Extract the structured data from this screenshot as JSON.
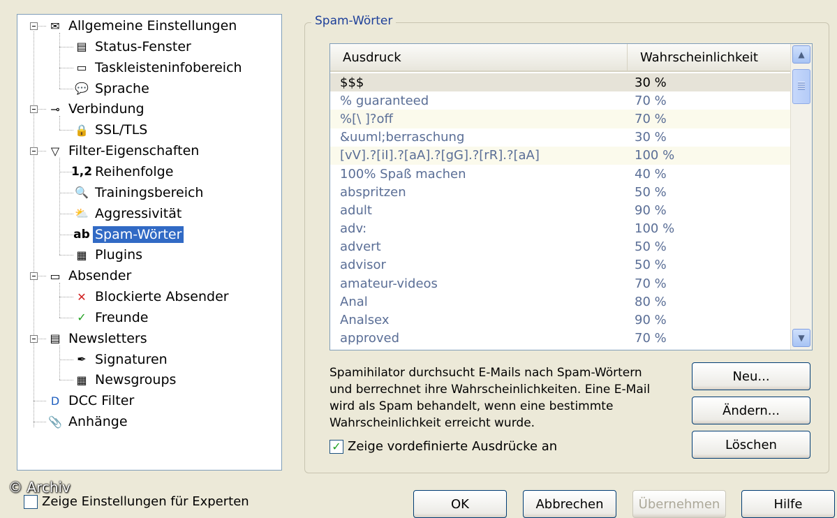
{
  "tree": {
    "items": [
      {
        "label": "Allgemeine Einstellungen",
        "icon": "envelope-settings-icon",
        "glyph": "✉"
      },
      {
        "label": "Status-Fenster",
        "icon": "status-window-icon",
        "glyph": "▤"
      },
      {
        "label": "Taskleisteninfobereich",
        "icon": "taskbar-icon",
        "glyph": "▭"
      },
      {
        "label": "Sprache",
        "icon": "language-bubble-icon",
        "glyph": "💬"
      },
      {
        "label": "Verbindung",
        "icon": "plug-icon",
        "glyph": "⊸"
      },
      {
        "label": "SSL/TLS",
        "icon": "lock-icon",
        "glyph": "🔒"
      },
      {
        "label": "Filter-Eigenschaften",
        "icon": "filter-icon",
        "glyph": "▽"
      },
      {
        "label": "Reihenfolge",
        "icon": "order-numbers-icon",
        "glyph": "1,2"
      },
      {
        "label": "Trainingsbereich",
        "icon": "training-icon",
        "glyph": "🔍"
      },
      {
        "label": "Aggressivität",
        "icon": "weather-icon",
        "glyph": "⛅"
      },
      {
        "label": "Spam-Wörter",
        "icon": "text-ab-icon",
        "glyph": "ab"
      },
      {
        "label": "Plugins",
        "icon": "plugins-icon",
        "glyph": "▦"
      },
      {
        "label": "Absender",
        "icon": "sender-card-icon",
        "glyph": "▭"
      },
      {
        "label": "Blockierte Absender",
        "icon": "red-x-icon",
        "glyph": "✕"
      },
      {
        "label": "Freunde",
        "icon": "green-check-icon",
        "glyph": "✓"
      },
      {
        "label": "Newsletters",
        "icon": "newsletter-icon",
        "glyph": "▤"
      },
      {
        "label": "Signaturen",
        "icon": "signature-icon",
        "glyph": "✒"
      },
      {
        "label": "Newsgroups",
        "icon": "newsgroups-icon",
        "glyph": "▦"
      },
      {
        "label": "DCC Filter",
        "icon": "dcc-icon",
        "glyph": "D"
      },
      {
        "label": "Anhänge",
        "icon": "paperclip-icon",
        "glyph": "📎"
      }
    ]
  },
  "group": {
    "title": "Spam-Wörter"
  },
  "list": {
    "columns": [
      "Ausdruck",
      "Wahrscheinlichkeit"
    ],
    "rows": [
      [
        "$$$",
        "30 %"
      ],
      [
        "% guaranteed",
        "70 %"
      ],
      [
        "%[\\ ]?off",
        "70 %"
      ],
      [
        "&uuml;berraschung",
        "30 %"
      ],
      [
        "[vV].?[iI].?[aA].?[gG].?[rR].?[aA]",
        "100 %"
      ],
      [
        "100% Spaß machen",
        "40 %"
      ],
      [
        "abspritzen",
        "50 %"
      ],
      [
        "adult",
        "90 %"
      ],
      [
        "adv:",
        "100 %"
      ],
      [
        "advert",
        "50 %"
      ],
      [
        "advisor",
        "50 %"
      ],
      [
        "amateur-videos",
        "70 %"
      ],
      [
        "Anal",
        "80 %"
      ],
      [
        "Analsex",
        "90 %"
      ],
      [
        "approved",
        "70 %"
      ]
    ]
  },
  "description": [
    "Spamihilator durchsucht E-Mails nach Spam-Wörtern",
    "und berrechnet ihre Wahrscheinlichkeiten. Eine E-Mail",
    "wird als Spam behandelt, wenn eine bestimmte",
    "Wahrscheinlichkeit erreicht wurde."
  ],
  "show_predefined": {
    "label": "Zeige vordefinierte Ausdrücke an",
    "checked": true
  },
  "buttons": {
    "new": "Neu...",
    "edit": "Ändern...",
    "delete": "Löschen",
    "ok": "OK",
    "cancel": "Abbrechen",
    "apply": "Übernehmen",
    "help": "Hilfe"
  },
  "expert": {
    "label": "Zeige Einstellungen für Experten"
  },
  "watermark": "© Archiv",
  "colors": {
    "selection": "#316ac5",
    "group_title": "#1d3f99",
    "dialog_bg": "#ece9d8"
  }
}
